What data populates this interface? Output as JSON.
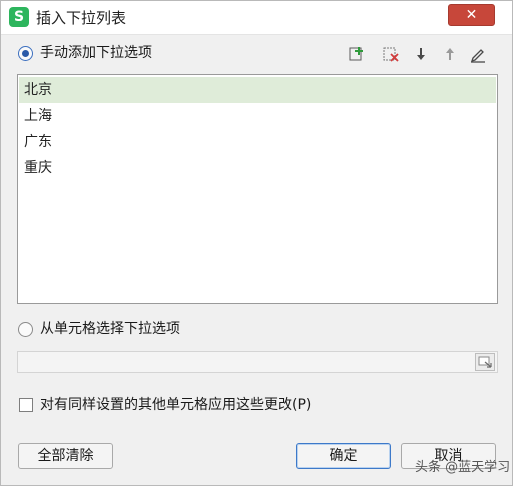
{
  "window": {
    "title": "插入下拉列表",
    "app_icon_letter": "S",
    "close_label": "✕"
  },
  "manual": {
    "label": "手动添加下拉选项",
    "selected": true,
    "tools": [
      {
        "icon": "add-item-icon"
      },
      {
        "icon": "delete-item-icon"
      },
      {
        "icon": "move-down-icon"
      },
      {
        "icon": "move-up-icon"
      },
      {
        "icon": "edit-item-icon"
      }
    ],
    "items": [
      "北京",
      "上海",
      "广东",
      "重庆"
    ],
    "selected_index": 0
  },
  "from_cells": {
    "label": "从单元格选择下拉选项",
    "selected": false,
    "value": ""
  },
  "apply_all": {
    "label": "对有同样设置的其他单元格应用这些更改(P)",
    "checked": false
  },
  "buttons": {
    "clear_all": "全部清除",
    "ok": "确定",
    "cancel": "取消"
  },
  "watermark": {
    "text": "头条 @蓝天学习"
  },
  "colors": {
    "close": "#c7473a",
    "app_icon": "#2db55d",
    "selected_row": "#dfecd9",
    "radio_dot": "#2b5aa8"
  }
}
